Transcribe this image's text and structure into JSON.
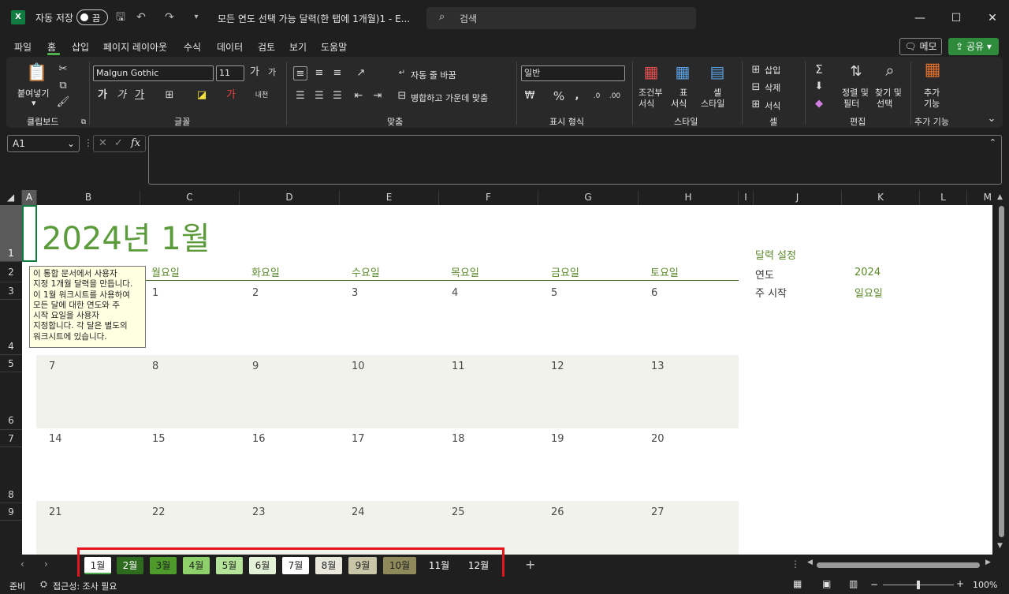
{
  "titlebar": {
    "app_icon": "excel-icon",
    "autosave_label": "자동 저장",
    "autosave_state": "끔",
    "doc_title": "모든 연도 선택 가능 달력(한 탭에 1개월)1 - E...",
    "search_placeholder": "검색"
  },
  "menu": {
    "tabs": [
      "파일",
      "홈",
      "삽입",
      "페이지 레이아웃",
      "수식",
      "데이터",
      "검토",
      "보기",
      "도움말"
    ],
    "active_tab": "홈",
    "memo_label": "메모",
    "share_label": "공유"
  },
  "ribbon": {
    "paste_label": "붙여넣기",
    "font_name": "Malgun Gothic",
    "font_size": "11",
    "wrap_label": "자동 줄 바꿈",
    "merge_label": "병합하고 가운데 맞춤",
    "number_format": "일반",
    "cond_format_label1": "조건부",
    "cond_format_label2": "서식",
    "table_label1": "표",
    "table_label2": "서식",
    "cell_style_label1": "셀",
    "cell_style_label2": "스타일",
    "insert_label": "삽입",
    "delete_label": "삭제",
    "format_label": "서식",
    "sort_label1": "정렬 및",
    "sort_label2": "필터",
    "find_label1": "찾기 및",
    "find_label2": "선택",
    "addins_label1": "추가",
    "addins_label2": "기능",
    "groups": {
      "clipboard": "클립보드",
      "font": "글꼴",
      "alignment": "맞춤",
      "number": "표시 형식",
      "styles": "스타일",
      "cells": "셀",
      "editing": "편집",
      "addins": "추가 기능"
    }
  },
  "formula": {
    "name_box": "A1",
    "fx": "fx"
  },
  "columns": [
    "A",
    "B",
    "C",
    "D",
    "E",
    "F",
    "G",
    "H",
    "I",
    "J",
    "K",
    "L",
    "M"
  ],
  "rows": [
    "1",
    "2",
    "3",
    "4",
    "5",
    "6",
    "7",
    "8",
    "9"
  ],
  "calendar": {
    "title": "2024년 1월",
    "weekdays": [
      "월요일",
      "화요일",
      "수요일",
      "목요일",
      "금요일",
      "토요일"
    ],
    "weeks": [
      [
        "1",
        "2",
        "3",
        "4",
        "5",
        "6"
      ],
      [
        "7",
        "8",
        "9",
        "10",
        "11",
        "12",
        "13"
      ],
      [
        "14",
        "15",
        "16",
        "17",
        "18",
        "19",
        "20"
      ],
      [
        "21",
        "22",
        "23",
        "24",
        "25",
        "26",
        "27"
      ]
    ]
  },
  "tooltip": {
    "lines": [
      "이 통합 문서에서 사용자",
      "지정 1개월 달력을 만듭니다.",
      "이 1월 워크시트를 사용하여",
      "모든 달에 대한 연도와 주",
      "시작 요일을 사용자",
      "지정합니다. 각 달은 별도의",
      "워크시트에 있습니다."
    ]
  },
  "settings": {
    "heading": "달력 설정",
    "year_label": "연도",
    "year_value": "2024",
    "week_start_label": "주 시작",
    "week_start_value": "일요일"
  },
  "sheet_tabs": [
    {
      "label": "1월",
      "bg": "#ffffff",
      "fg": "#222222"
    },
    {
      "label": "2월",
      "bg": "#2e6b1f",
      "fg": "#ffffff"
    },
    {
      "label": "3월",
      "bg": "#4e9a2a",
      "fg": "#1f1f1f"
    },
    {
      "label": "4월",
      "bg": "#8ed16a",
      "fg": "#1f1f1f"
    },
    {
      "label": "5월",
      "bg": "#b6e39a",
      "fg": "#1f1f1f"
    },
    {
      "label": "6월",
      "bg": "#e3f2d6",
      "fg": "#1f1f1f"
    },
    {
      "label": "7월",
      "bg": "#ffffff",
      "fg": "#1f1f1f"
    },
    {
      "label": "8월",
      "bg": "#e9e8dc",
      "fg": "#1f1f1f"
    },
    {
      "label": "9월",
      "bg": "#c9c6a8",
      "fg": "#1f1f1f"
    },
    {
      "label": "10월",
      "bg": "#8f8a5b",
      "fg": "#1f1f1f"
    },
    {
      "label": "11월",
      "bg": "#1f1f1f",
      "fg": "#ffffff"
    },
    {
      "label": "12월",
      "bg": "#1f1f1f",
      "fg": "#ffffff"
    }
  ],
  "status": {
    "ready": "준비",
    "accessibility": "접근성: 조사 필요",
    "zoom": "100%"
  },
  "colors": {
    "accent_green": "#5c9b3b",
    "highlight_red": "#e8141c"
  }
}
